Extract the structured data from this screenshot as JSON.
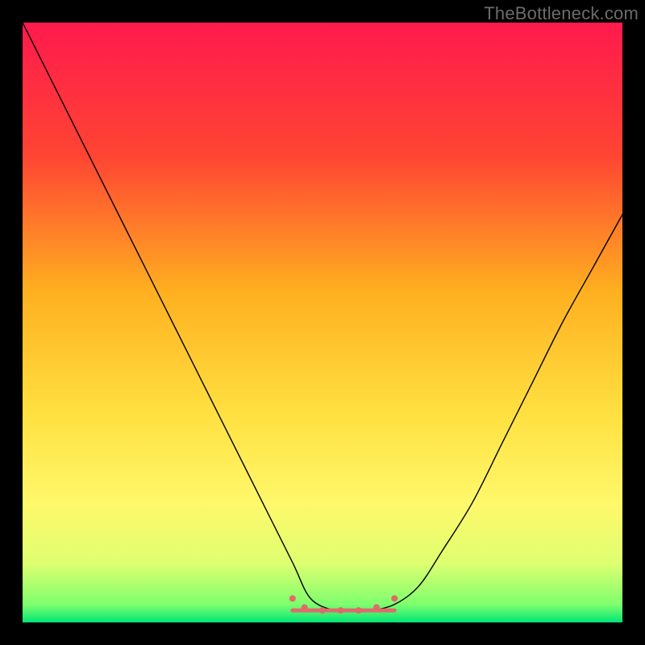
{
  "watermark": "TheBottleneck.com",
  "chart_data": {
    "type": "line",
    "title": "",
    "xlabel": "",
    "ylabel": "",
    "xlim": [
      0,
      100
    ],
    "ylim": [
      0,
      100
    ],
    "background_gradient": {
      "direction": "vertical",
      "stops": [
        {
          "pos": 0.0,
          "color": "#ff1a4d"
        },
        {
          "pos": 0.22,
          "color": "#ff4433"
        },
        {
          "pos": 0.45,
          "color": "#ffb020"
        },
        {
          "pos": 0.65,
          "color": "#ffe040"
        },
        {
          "pos": 0.8,
          "color": "#fff86a"
        },
        {
          "pos": 0.9,
          "color": "#dfff70"
        },
        {
          "pos": 0.97,
          "color": "#7fff6e"
        },
        {
          "pos": 1.0,
          "color": "#00e676"
        }
      ]
    },
    "series": [
      {
        "name": "curve",
        "color": "#000000",
        "width": 1.4,
        "x": [
          0,
          5,
          10,
          15,
          20,
          25,
          30,
          35,
          40,
          45,
          48,
          52,
          55,
          58,
          62,
          66,
          70,
          75,
          80,
          85,
          90,
          95,
          100
        ],
        "y": [
          100,
          90,
          80,
          70,
          60,
          50,
          40,
          30,
          20,
          10,
          4,
          2,
          2,
          2,
          3,
          6,
          12,
          20,
          30,
          40,
          50,
          59,
          68
        ]
      },
      {
        "name": "bottom-marks",
        "color": "#e06a6a",
        "width": 5,
        "type": "segment",
        "x": [
          45,
          62
        ],
        "y": [
          2,
          2
        ]
      }
    ],
    "bottom_dots": {
      "color": "#e06a6a",
      "radius": 4,
      "points": [
        {
          "x": 45,
          "y": 4
        },
        {
          "x": 47,
          "y": 2.5
        },
        {
          "x": 50,
          "y": 2
        },
        {
          "x": 53,
          "y": 2
        },
        {
          "x": 56,
          "y": 2
        },
        {
          "x": 59,
          "y": 2.5
        },
        {
          "x": 62,
          "y": 4
        }
      ]
    }
  }
}
